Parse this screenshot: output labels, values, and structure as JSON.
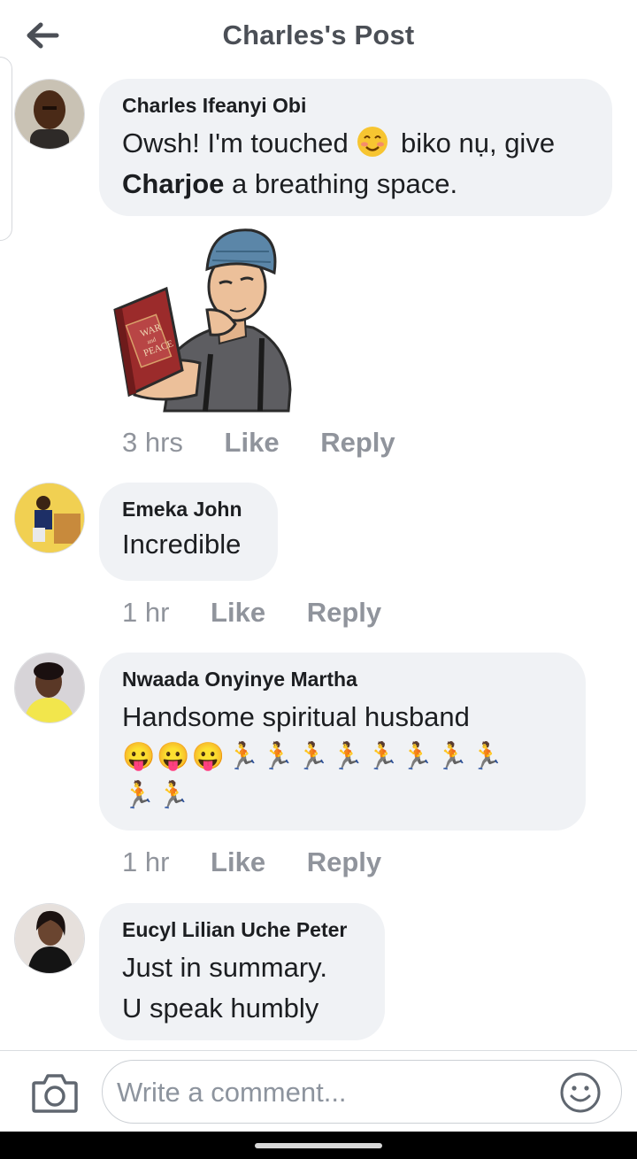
{
  "header": {
    "title": "Charles's Post"
  },
  "comments": [
    {
      "author": "Charles Ifeanyi Obi",
      "line1_before": "Owsh! I'm touched",
      "line1_after": "biko nụ, give",
      "line2_bold": "Charjoe",
      "line2_rest": "a breathing space.",
      "sticker_text_1": "WAR",
      "sticker_text_2": "and",
      "sticker_text_3": "PEACE",
      "time": "3 hrs",
      "like": "Like",
      "reply": "Reply"
    },
    {
      "author": "Emeka John",
      "text": "Incredible",
      "time": "1 hr",
      "like": "Like",
      "reply": "Reply"
    },
    {
      "author": "Nwaada Onyinye Martha",
      "text": "Handsome spiritual husband",
      "emoji_line": "😛😛😛🏃🏃🏃🏃🏃🏃🏃🏃",
      "emoji_line2": "🏃🏃",
      "time": "1 hr",
      "like": "Like",
      "reply": "Reply"
    },
    {
      "author": "Eucyl Lilian Uche Peter",
      "line1": "Just in summary.",
      "line2": "U speak humbly"
    }
  ],
  "composer": {
    "placeholder": "Write a comment..."
  },
  "colors": {
    "bubble": "#f0f2f5",
    "meta": "#90949c",
    "title": "#4b4f56"
  },
  "icons": [
    "back-arrow-icon",
    "camera-icon",
    "smiley-icon"
  ]
}
